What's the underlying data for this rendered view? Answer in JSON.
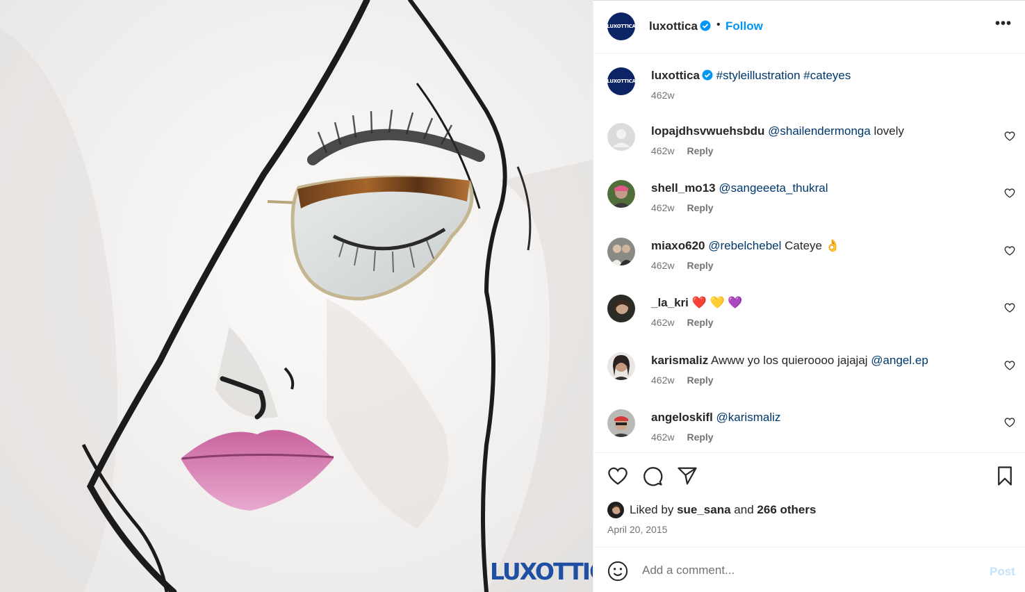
{
  "post": {
    "author": "luxottica",
    "follow_label": "Follow",
    "more_label": "•••",
    "brand_watermark": "LUXOTTICA",
    "avatar_text": "LUXOTTICA"
  },
  "caption": {
    "username": "luxottica",
    "text": "#styleillustration #cateyes",
    "time": "462w"
  },
  "comments": [
    {
      "username": "lopajdhsvwuehsbdu",
      "mention": "@shailendermonga",
      "text": " lovely",
      "time": "462w",
      "reply": "Reply"
    },
    {
      "username": "shell_mo13",
      "mention": "@sangeeeta_thukral",
      "text": "",
      "time": "462w",
      "reply": "Reply"
    },
    {
      "username": "miaxo620",
      "mention": "@rebelchebel",
      "text": " Cateye 👌",
      "time": "462w",
      "reply": "Reply"
    },
    {
      "username": "_la_kri",
      "mention": "",
      "text": "❤️ 💛 💜",
      "time": "462w",
      "reply": "Reply"
    },
    {
      "username": "karismaliz",
      "mention": "",
      "text": "Awww yo los quieroooo jajajaj ",
      "mention_after": "@angel.ep",
      "time": "462w",
      "reply": "Reply"
    },
    {
      "username": "angeloskifl",
      "mention": "@karismaliz",
      "text": "",
      "time": "462w",
      "reply": "Reply"
    }
  ],
  "likes": {
    "prefix": "Liked by ",
    "user": "sue_sana",
    "middle": " and ",
    "others": "266 others"
  },
  "date": "April 20, 2015",
  "composer": {
    "placeholder": "Add a comment...",
    "post_label": "Post"
  },
  "colors": {
    "accent": "#0095f6",
    "mention": "#00376b",
    "brand": "#0c2466",
    "post_disabled": "#c5e2fc"
  }
}
